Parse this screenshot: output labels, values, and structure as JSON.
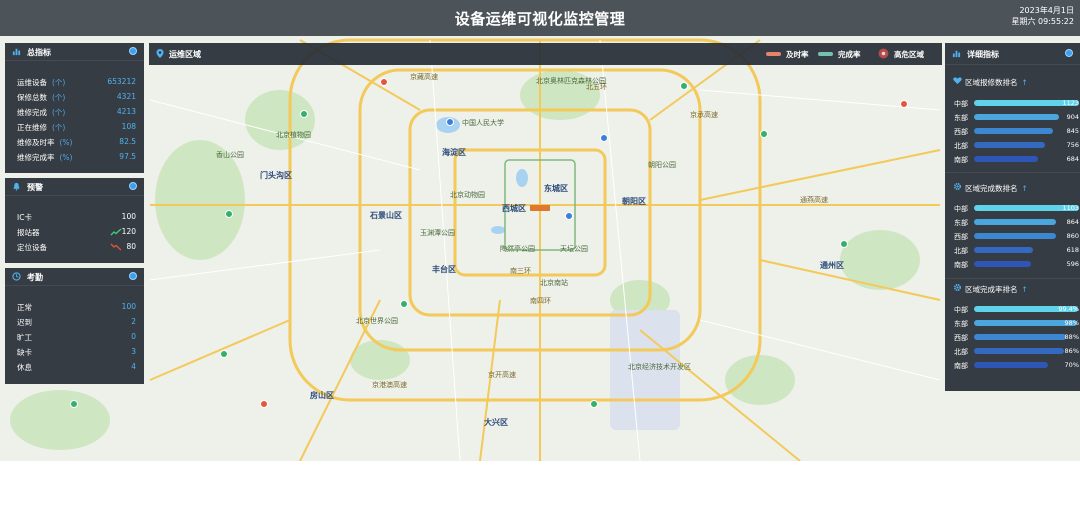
{
  "header": {
    "title": "设备运维可视化监控管理",
    "date": "2023年4月1日",
    "time": "星期六 09:55:22"
  },
  "colors": {
    "panel_bg": "#282e36",
    "accent": "#4fb3ef",
    "overtime": "#e8836b",
    "complete": "#74c3b0",
    "high_freq": "#b24b4b"
  },
  "left_panels": [
    {
      "title": "总指标",
      "icon": "bar-chart-icon",
      "rows": [
        {
          "label": "运维设备",
          "unit": "(个)",
          "value": "653212"
        },
        {
          "label": "保修总数",
          "unit": "(个)",
          "value": "4321"
        },
        {
          "label": "维修完成",
          "unit": "(个)",
          "value": "4213"
        },
        {
          "label": "正在维修",
          "unit": "(个)",
          "value": "108"
        },
        {
          "label": "维修及时率",
          "unit": "(%)",
          "value": "82.5"
        },
        {
          "label": "维修完成率",
          "unit": "(%)",
          "value": "97.5"
        }
      ]
    },
    {
      "title": "预警",
      "icon": "bell-icon",
      "rows": [
        {
          "label": "IC卡",
          "value": "100",
          "trend": "none"
        },
        {
          "label": "报站器",
          "value": "120",
          "trend": "up"
        },
        {
          "label": "定位设备",
          "value": "80",
          "trend": "down"
        }
      ]
    },
    {
      "title": "考勤",
      "icon": "clock-icon",
      "rows": [
        {
          "label": "正常",
          "value": "100"
        },
        {
          "label": "迟到",
          "value": "2"
        },
        {
          "label": "旷工",
          "value": "0"
        },
        {
          "label": "缺卡",
          "value": "3"
        },
        {
          "label": "休息",
          "value": "4"
        }
      ]
    }
  ],
  "map_header": {
    "title": "运维区域",
    "legend": [
      {
        "label": "及时率",
        "color": "#e8836b"
      },
      {
        "label": "完成率",
        "color": "#74c3b0"
      },
      {
        "label": "高危区域",
        "color": "#b24b4b"
      }
    ]
  },
  "right_panel": {
    "title": "详细指标",
    "sections": [
      {
        "title": "区域报修数排名",
        "icon": "heart-icon",
        "rows": [
          {
            "label": "中部",
            "value": "1123",
            "frac": 1.0,
            "color": "#5fd3ea"
          },
          {
            "label": "东部",
            "value": "904",
            "frac": 0.805,
            "color": "#4aa6dc"
          },
          {
            "label": "西部",
            "value": "845",
            "frac": 0.752,
            "color": "#3d86d0"
          },
          {
            "label": "北部",
            "value": "756",
            "frac": 0.673,
            "color": "#3469c2"
          },
          {
            "label": "南部",
            "value": "684",
            "frac": 0.609,
            "color": "#2d56b6"
          }
        ]
      },
      {
        "title": "区域完成数排名",
        "icon": "gear-icon",
        "rows": [
          {
            "label": "中部",
            "value": "1103",
            "frac": 1.0,
            "color": "#5fd3ea"
          },
          {
            "label": "东部",
            "value": "864",
            "frac": 0.783,
            "color": "#4aa6dc"
          },
          {
            "label": "西部",
            "value": "860",
            "frac": 0.78,
            "color": "#3d86d0"
          },
          {
            "label": "北部",
            "value": "618",
            "frac": 0.56,
            "color": "#3469c2"
          },
          {
            "label": "南部",
            "value": "596",
            "frac": 0.54,
            "color": "#2d56b6"
          }
        ]
      },
      {
        "title": "区域完成率排名",
        "icon": "gear-icon",
        "rows": [
          {
            "label": "中部",
            "value": "99.4%",
            "frac": 0.994,
            "color": "#5fd3ea"
          },
          {
            "label": "东部",
            "value": "98%",
            "frac": 0.98,
            "color": "#4aa6dc"
          },
          {
            "label": "西部",
            "value": "88%",
            "frac": 0.88,
            "color": "#3d86d0"
          },
          {
            "label": "北部",
            "value": "86%",
            "frac": 0.86,
            "color": "#3469c2"
          },
          {
            "label": "南部",
            "value": "70%",
            "frac": 0.7,
            "color": "#2d56b6"
          }
        ]
      }
    ]
  },
  "map_labels": {
    "districts": [
      "海淀区",
      "西城区",
      "东城区",
      "朝阳区",
      "丰台区",
      "石景山区",
      "门头沟区",
      "通州区",
      "大兴区",
      "房山区"
    ],
    "roads": [
      "北五环",
      "南四环",
      "南三环",
      "京开高速",
      "京港澳高速",
      "京藏高速",
      "京承高速",
      "通燕高速"
    ],
    "poi": [
      "北京奥林匹克森林公园",
      "中国人民大学",
      "朝阳公园",
      "北京动物园",
      "天坛公园",
      "北京世界公园",
      "北京经济技术开发区",
      "北京植物园",
      "香山公园",
      "玉渊潭公园",
      "陶然亭公园",
      "北京南站"
    ]
  }
}
